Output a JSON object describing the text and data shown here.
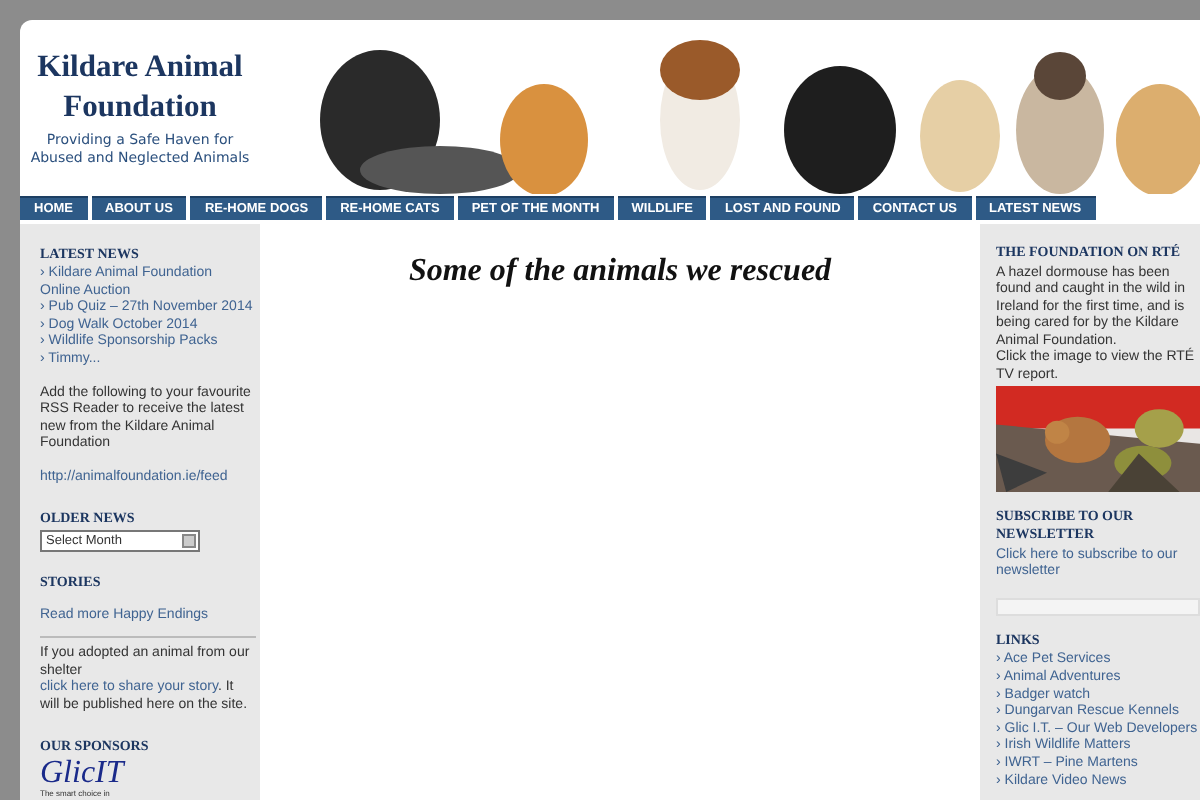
{
  "site": {
    "title": "Kildare Animal Foundation",
    "tagline": "Providing a Safe Haven for Abused and Neglected Animals"
  },
  "nav": [
    "HOME",
    "ABOUT US",
    "RE-HOME DOGS",
    "RE-HOME CATS",
    "PET OF THE MONTH",
    "WILDLIFE",
    "LOST AND FOUND",
    "CONTACT US",
    "LATEST NEWS"
  ],
  "left_sidebar": {
    "latest_news": {
      "heading": "LATEST NEWS",
      "items": [
        "› Kildare Animal Foundation Online Auction",
        "› Pub Quiz – 27th November 2014",
        "› Dog Walk October 2014",
        "› Wildlife Sponsorship Packs",
        "› Timmy..."
      ]
    },
    "rss": {
      "text": "Add the following to your favourite RSS Reader to receive the latest new from the Kildare Animal Foundation",
      "link": "http://animalfoundation.ie/feed"
    },
    "older_news": {
      "heading": "OLDER NEWS",
      "select": "Select Month"
    },
    "stories": {
      "heading": "STORIES",
      "link": "Read more Happy Endings",
      "text_before": "If you adopted an animal from our shelter ",
      "text_link": "click here to share your story",
      "text_after": ". It will be published here on the site."
    },
    "sponsors": {
      "heading": "OUR SPONSORS",
      "logo": "GlicIT",
      "logo_tagline": "The smart choice in"
    }
  },
  "main": {
    "heading": "Some of the animals we rescued"
  },
  "right_sidebar": {
    "rte": {
      "heading": "THE FOUNDATION ON RTÉ",
      "text": "A hazel dormouse has been found and caught in the wild in Ireland for the first time, and is being cared for by the Kildare Animal Foundation.",
      "text2": "Click the image to view the RTÉ TV report."
    },
    "newsletter": {
      "heading": "SUBSCRIBE TO OUR NEWSLETTER",
      "link": "Click here to subscribe to our newsletter"
    },
    "links": {
      "heading": "LINKS",
      "items": [
        "› Ace Pet Services",
        "› Animal Adventures",
        "› Badger watch",
        "› Dungarvan Rescue Kennels",
        "› Glic I.T. – Our Web Developers",
        "› Irish Wildlife Matters",
        "› IWRT – Pine Martens",
        "› Kildare Video News"
      ]
    }
  }
}
